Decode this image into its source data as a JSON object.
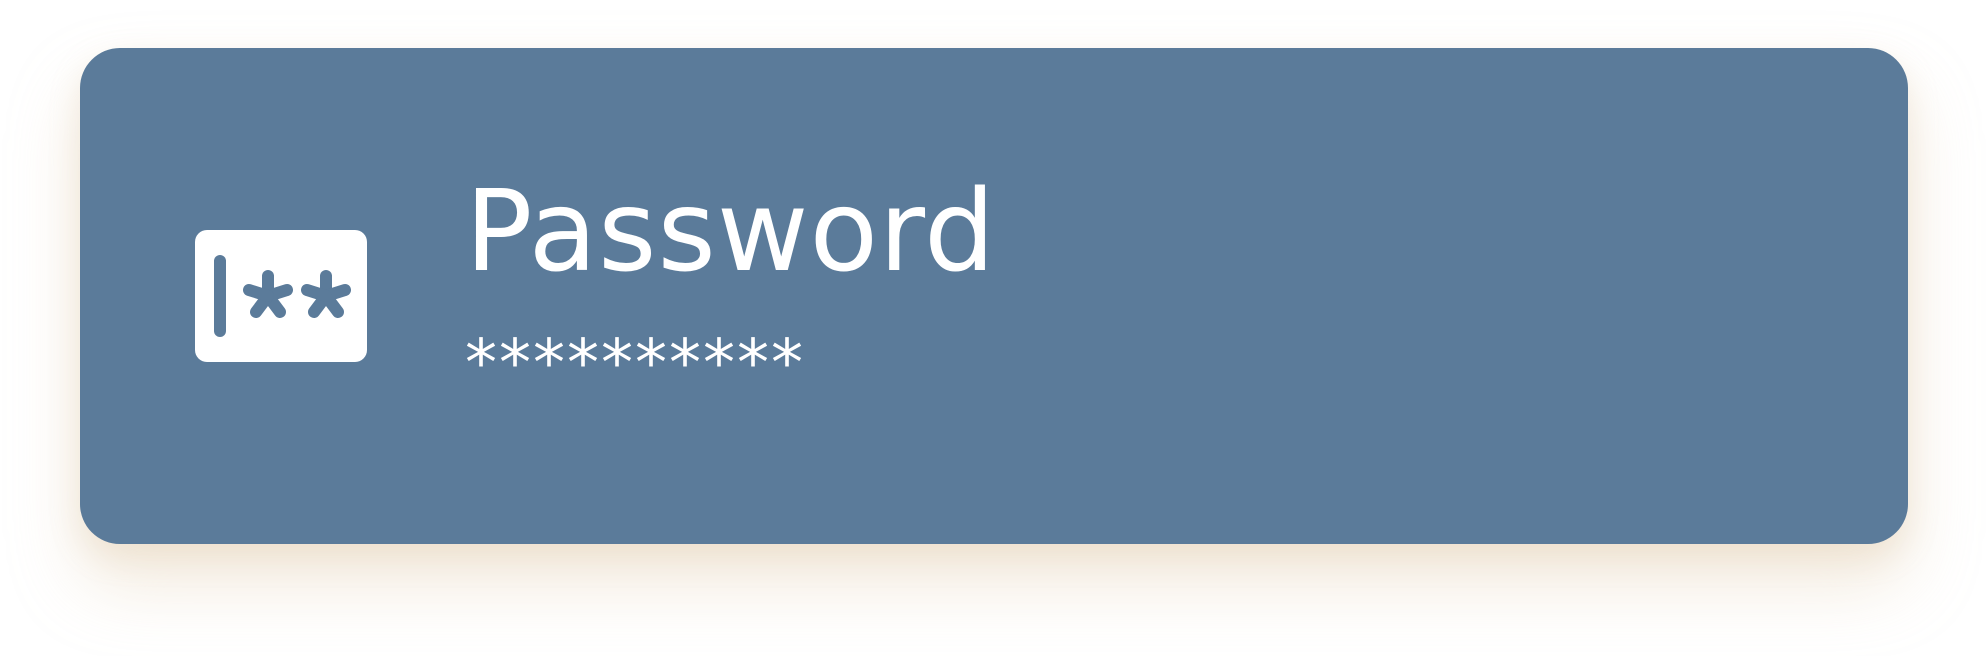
{
  "card": {
    "icon": "password-field-icon",
    "title": "Password",
    "masked_value": "**********",
    "colors": {
      "card_background": "#5b7b9a",
      "foreground": "#ffffff"
    }
  }
}
